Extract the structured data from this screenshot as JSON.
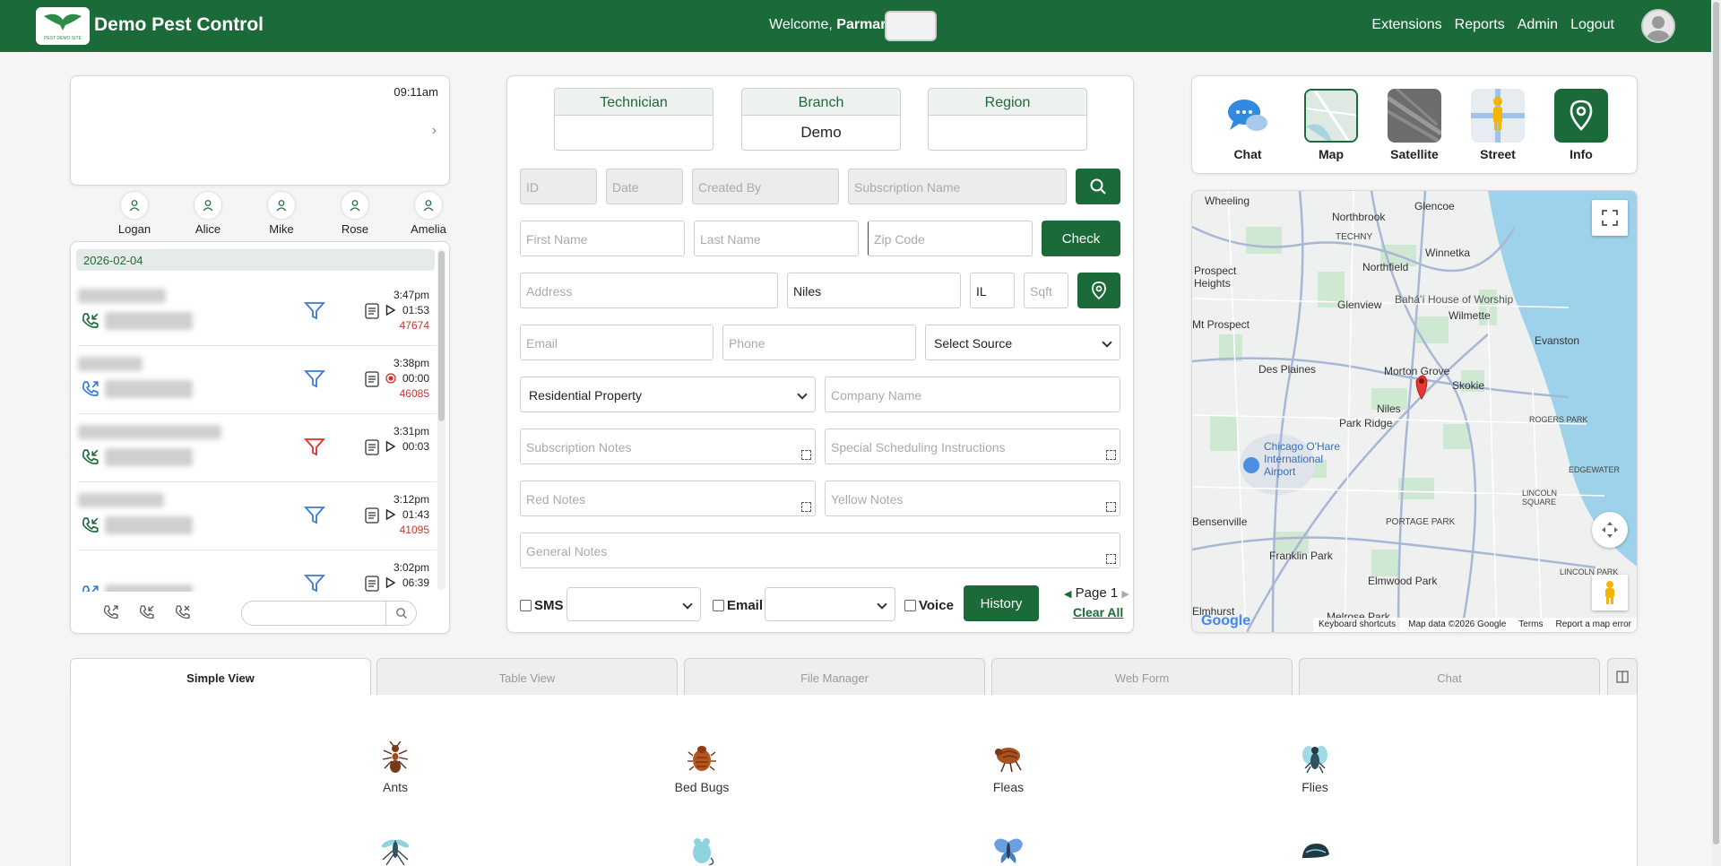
{
  "header": {
    "brand": "Demo Pest Control",
    "logo_text": "PEST DEMO SITE",
    "welcome_prefix": "Welcome, ",
    "user": "Parmar",
    "welcome_suffix": "!",
    "nav": [
      "Extensions",
      "Reports",
      "Admin",
      "Logout"
    ],
    "accent": "#1b6b3a"
  },
  "clock": {
    "time": "09:11am"
  },
  "technicians": [
    "Logan",
    "Alice",
    "Mike",
    "Rose",
    "Amelia"
  ],
  "calls": {
    "date": "2026-02-04",
    "rows": [
      {
        "time": "3:47pm",
        "duration": "01:53",
        "number": "47674",
        "direction": "incoming",
        "filter_color": "#3b7bd4",
        "media": "play"
      },
      {
        "time": "3:38pm",
        "duration": "00:00",
        "number": "46085",
        "direction": "outgoing",
        "filter_color": "#3b7bd4",
        "media": "record"
      },
      {
        "time": "3:31pm",
        "duration": "00:03",
        "number": "",
        "direction": "incoming",
        "filter_color": "#e03131",
        "media": "play"
      },
      {
        "time": "3:12pm",
        "duration": "01:43",
        "number": "41095",
        "direction": "incoming",
        "filter_color": "#3b7bd4",
        "media": "play"
      },
      {
        "time": "3:02pm",
        "duration": "06:39",
        "number": "",
        "direction": "outgoing",
        "filter_color": "#3b7bd4",
        "media": "play"
      }
    ]
  },
  "form": {
    "tabs": [
      {
        "title": "Technician",
        "value": ""
      },
      {
        "title": "Branch",
        "value": "Demo"
      },
      {
        "title": "Region",
        "value": ""
      }
    ],
    "placeholders": {
      "id": "ID",
      "date": "Date",
      "created_by": "Created By",
      "subscription_name": "Subscription Name",
      "first_name": "First Name",
      "last_name": "Last Name",
      "zip": "Zip Code",
      "address": "Address",
      "sqft": "Sqft",
      "email": "Email",
      "phone": "Phone",
      "company": "Company Name",
      "sub_notes": "Subscription Notes",
      "sched": "Special Scheduling Instructions",
      "red_notes": "Red Notes",
      "yellow_notes": "Yellow Notes",
      "general_notes": "General Notes"
    },
    "values": {
      "city": "Niles",
      "state": "IL"
    },
    "select_source": "Select Source",
    "property_type": "Residential Property",
    "check_label": "Check",
    "sms_label": "SMS",
    "email_label": "Email",
    "voice_label": "Voice",
    "history_label": "History",
    "page_label": "Page 1",
    "clear_all": "Clear All"
  },
  "views": [
    {
      "label": "Chat",
      "icon": "chat-bubbles-icon"
    },
    {
      "label": "Map",
      "icon": "map-thumb-icon"
    },
    {
      "label": "Satellite",
      "icon": "satellite-thumb-icon"
    },
    {
      "label": "Street",
      "icon": "street-view-icon"
    },
    {
      "label": "Info",
      "icon": "location-pin-icon"
    }
  ],
  "map": {
    "labels": [
      "Wheeling",
      "Glencoe",
      "Northbrook",
      "TECHNY",
      "Winnetka",
      "Prospect Heights",
      "Northfield",
      "Glenview",
      "Bahá'í House of Worship",
      "Wilmette",
      "Mt Prospect",
      "Evanston",
      "Des Plaines",
      "Morton Grove",
      "Skokie",
      "Niles",
      "ROGERS PARK",
      "Park Ridge",
      "Chicago O'Hare International Airport",
      "EDGEWATER",
      "LINCOLN SQUARE",
      "Bensenville",
      "PORTAGE PARK",
      "Franklin Park",
      "Elmwood Park",
      "LINCOLN PARK",
      "Elmhurst",
      "Melrose Park"
    ],
    "footer": [
      "Keyboard shortcuts",
      "Map data ©2026 Google",
      "Terms",
      "Report a map error"
    ],
    "google": "Google"
  },
  "bottom_tabs": [
    "Simple View",
    "Table View",
    "File Manager",
    "Web Form",
    "Chat"
  ],
  "pests": [
    "Ants",
    "Bed Bugs",
    "Fleas",
    "Flies"
  ]
}
